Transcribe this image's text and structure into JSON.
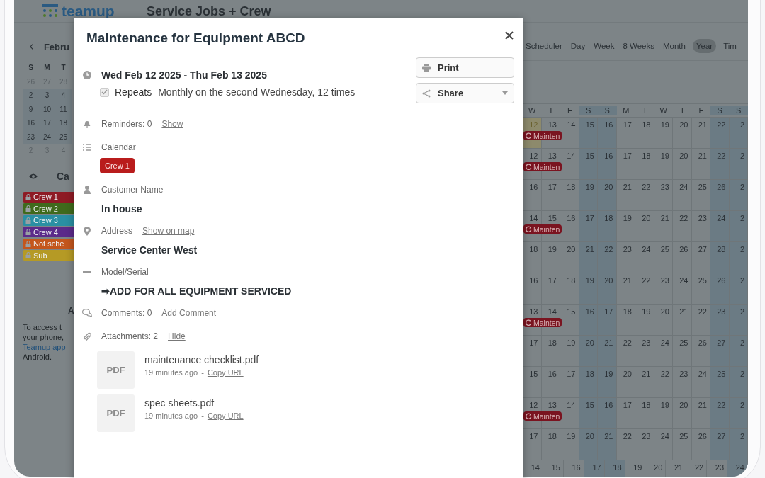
{
  "header": {
    "logo": "teamup",
    "title": "Service Jobs + Crew"
  },
  "sidebar": {
    "month": "Febru",
    "weekdays": [
      "S",
      "M",
      "T"
    ],
    "mini_calendar": [
      {
        "days": [
          "26",
          "27",
          "28"
        ],
        "current_month": false
      },
      {
        "days": [
          "2",
          "3",
          "4"
        ],
        "current_month": true
      },
      {
        "days": [
          "9",
          "10",
          "11"
        ],
        "current_month": true
      },
      {
        "days": [
          "16",
          "17",
          "18"
        ],
        "current_month": true
      },
      {
        "days": [
          "23",
          "24",
          "25"
        ],
        "current_month": true
      },
      {
        "days": [
          "2",
          "3",
          "4"
        ],
        "current_month": false
      }
    ],
    "calendars_heading": "Ca",
    "calendars": [
      {
        "label": "Crew 1",
        "color": "#8e1a24"
      },
      {
        "label": "Crew 2",
        "color": "#3f6a1c"
      },
      {
        "label": "Crew 3",
        "color": "#2a8fa3"
      },
      {
        "label": "Crew 4",
        "color": "#5b2a8a"
      },
      {
        "label": "Not sche",
        "color": "#c4561c"
      },
      {
        "label": "Sub",
        "color": "#b59a25"
      }
    ],
    "section_heading": "A",
    "access_note": [
      {
        "text": "To access t",
        "link": false
      },
      {
        "text": "your phone,",
        "link": false
      },
      {
        "text": "Teamup app",
        "link": true
      },
      {
        "text": "Android.",
        "link": false
      }
    ]
  },
  "views": [
    {
      "label": "Scheduler",
      "selected": false
    },
    {
      "label": "Day",
      "selected": false
    },
    {
      "label": "Week",
      "selected": false
    },
    {
      "label": "8 Weeks",
      "selected": false
    },
    {
      "label": "Month",
      "selected": false
    },
    {
      "label": "Year",
      "selected": true
    },
    {
      "label": "Tim",
      "selected": false
    }
  ],
  "year_grid": {
    "weekdays": [
      {
        "label": "W",
        "weekend": false
      },
      {
        "label": "T",
        "weekend": false
      },
      {
        "label": "F",
        "weekend": false
      },
      {
        "label": "S",
        "weekend": true
      },
      {
        "label": "S",
        "weekend": true
      },
      {
        "label": "M",
        "weekend": false
      },
      {
        "label": "T",
        "weekend": false
      },
      {
        "label": "W",
        "weekend": false
      },
      {
        "label": "T",
        "weekend": false
      },
      {
        "label": "F",
        "weekend": false
      },
      {
        "label": "S",
        "weekend": true
      },
      {
        "label": "S",
        "weekend": true
      }
    ],
    "rows": [
      {
        "days": [
          "12",
          "13",
          "14",
          "15",
          "16",
          "17",
          "18",
          "19",
          "20",
          "21",
          "22",
          "2"
        ],
        "event": "Mainten",
        "today": true
      },
      {
        "days": [
          "12",
          "13",
          "14",
          "15",
          "16",
          "17",
          "18",
          "19",
          "20",
          "21",
          "22",
          "2"
        ],
        "event": "Mainten",
        "today": false
      },
      {
        "days": [
          "16",
          "17",
          "18",
          "19",
          "20",
          "21",
          "22",
          "23",
          "24",
          "25",
          "26",
          "2"
        ],
        "today": false
      },
      {
        "days": [
          "14",
          "15",
          "16",
          "17",
          "18",
          "19",
          "20",
          "21",
          "22",
          "23",
          "24",
          "2"
        ],
        "event": "Mainten",
        "today": false
      },
      {
        "days": [
          "18",
          "19",
          "20",
          "21",
          "22",
          "23",
          "24",
          "25",
          "26",
          "27",
          "28",
          "2"
        ],
        "today": false
      },
      {
        "days": [
          "16",
          "17",
          "18",
          "19",
          "20",
          "21",
          "22",
          "23",
          "24",
          "25",
          "26",
          "2"
        ],
        "today": false
      },
      {
        "days": [
          "13",
          "14",
          "15",
          "16",
          "17",
          "18",
          "19",
          "20",
          "21",
          "22",
          "23",
          "2"
        ],
        "event": "Mainten",
        "today": false
      },
      {
        "days": [
          "17",
          "18",
          "19",
          "20",
          "21",
          "22",
          "23",
          "24",
          "25",
          "26",
          "27",
          "2"
        ],
        "today": false
      },
      {
        "days": [
          "15",
          "16",
          "17",
          "18",
          "19",
          "20",
          "21",
          "22",
          "23",
          "24",
          "25",
          "2"
        ],
        "today": false
      },
      {
        "days": [
          "12",
          "13",
          "14",
          "15",
          "16",
          "17",
          "18",
          "19",
          "20",
          "21",
          "22",
          "2"
        ],
        "event": "Mainten",
        "today": false
      },
      {
        "days": [
          "17",
          "18",
          "19",
          "20",
          "21",
          "22",
          "23",
          "24",
          "25",
          "26",
          "27",
          "2"
        ],
        "today": false
      },
      {
        "days": [
          "14",
          "15",
          "16",
          "17",
          "18",
          "19",
          "20",
          "21",
          "22",
          "23",
          "24"
        ],
        "today": false
      }
    ]
  },
  "modal": {
    "title": "Maintenance for Equipment ABCD",
    "date": "Wed Feb 12 2025 - Thu Feb 13 2025",
    "repeats": {
      "label": "Repeats",
      "checked": true,
      "rule": "Monthly on the second Wednesday, 12 times"
    },
    "buttons": [
      {
        "label": "Print",
        "kind": "print"
      },
      {
        "label": "Share",
        "kind": "share"
      }
    ],
    "fields": [
      {
        "kind": "inline",
        "label": "Reminders: 0",
        "link": "Show"
      },
      {
        "kind": "chip",
        "label": "Calendar",
        "chip": {
          "label": "Crew 1",
          "color": "#b91c1c"
        }
      },
      {
        "kind": "value",
        "label": "Customer Name",
        "value": "In house"
      },
      {
        "kind": "value",
        "label": "Address",
        "link": "Show on map",
        "value": "Service Center West"
      },
      {
        "kind": "value",
        "label": "Model/Serial",
        "value": "➡ADD FOR ALL EQUIPMENT SERVICED"
      },
      {
        "kind": "inline",
        "label": "Comments: 0",
        "link": "Add Comment"
      },
      {
        "kind": "inline",
        "label": "Attachments: 2",
        "link": "Hide"
      }
    ],
    "attachments": [
      {
        "thumb": "PDF",
        "name": "maintenance checklist.pdf",
        "time": "19 minutes ago",
        "separator": "-",
        "link": "Copy URL"
      },
      {
        "thumb": "PDF",
        "name": "spec sheets.pdf",
        "time": "19 minutes ago",
        "separator": "-",
        "link": "Copy URL"
      }
    ]
  }
}
